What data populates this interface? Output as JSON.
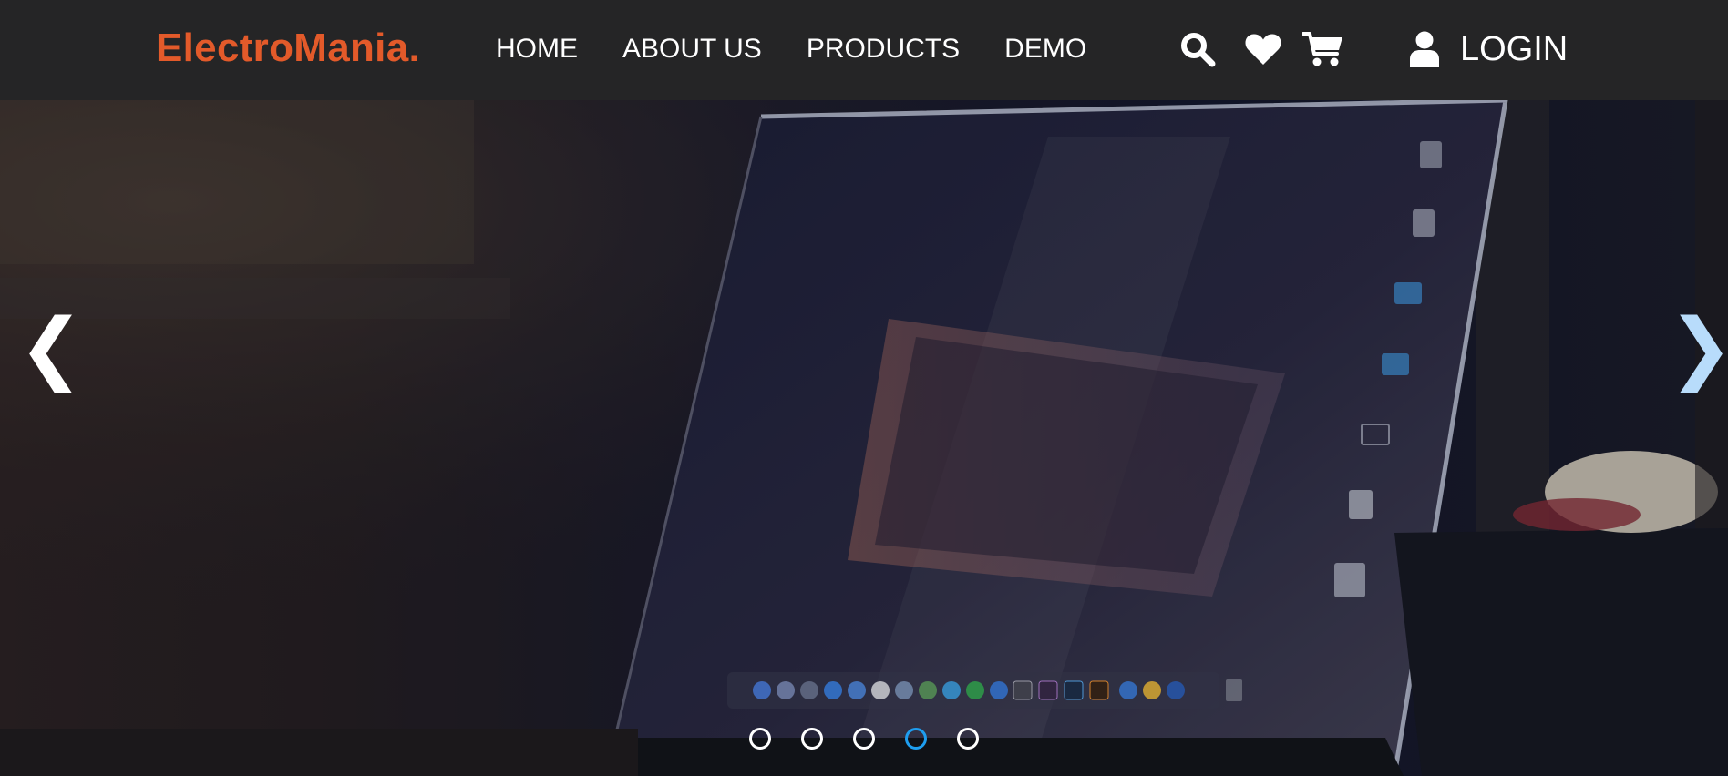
{
  "brand": {
    "name": "ElectroMania.",
    "color": "#e35a2a"
  },
  "nav": {
    "links": [
      "HOME",
      "ABOUT US",
      "PRODUCTS",
      "DEMO"
    ]
  },
  "actions": {
    "search_icon": "search-icon",
    "wishlist_icon": "heart-icon",
    "cart_icon": "cart-icon",
    "login_icon": "user-icon",
    "login_label": "LOGIN"
  },
  "carousel": {
    "prev_glyph": "❮",
    "next_glyph": "❯",
    "slide_count": 5,
    "active_slide_index": 3,
    "active_dot_color": "#1e9ef0",
    "slide_image": "laptop-on-desk-photo"
  }
}
